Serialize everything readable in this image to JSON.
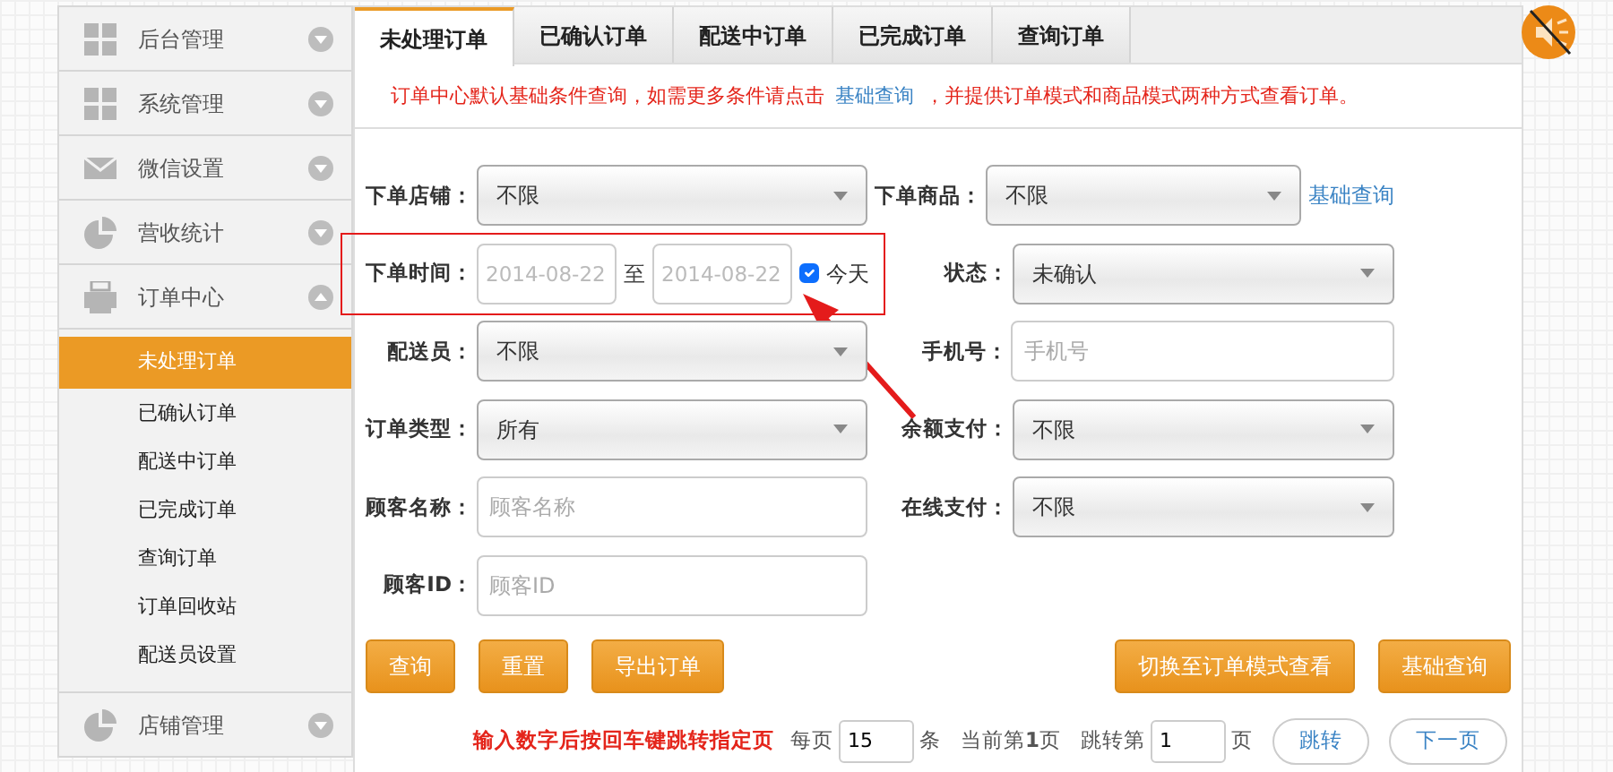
{
  "sidebar": {
    "items": [
      {
        "label": "后台管理",
        "kind": "grid",
        "expanded": false
      },
      {
        "label": "系统管理",
        "kind": "grid",
        "expanded": false
      },
      {
        "label": "微信设置",
        "kind": "mail",
        "expanded": false
      },
      {
        "label": "营收统计",
        "kind": "pie",
        "expanded": false
      },
      {
        "label": "订单中心",
        "kind": "printer",
        "expanded": true,
        "children": [
          {
            "label": "未处理订单",
            "selected": true
          },
          {
            "label": "已确认订单",
            "selected": false
          },
          {
            "label": "配送中订单",
            "selected": false
          },
          {
            "label": "已完成订单",
            "selected": false
          },
          {
            "label": "查询订单",
            "selected": false
          },
          {
            "label": "订单回收站",
            "selected": false
          },
          {
            "label": "配送员设置",
            "selected": false
          }
        ]
      },
      {
        "label": "店铺管理",
        "kind": "pie",
        "expanded": false
      }
    ]
  },
  "tabs": [
    {
      "label": "未处理订单",
      "selected": true
    },
    {
      "label": "已确认订单",
      "selected": false
    },
    {
      "label": "配送中订单",
      "selected": false
    },
    {
      "label": "已完成订单",
      "selected": false
    },
    {
      "label": "查询订单",
      "selected": false
    }
  ],
  "notice": {
    "text": "订单中心默认基础条件查询，如需更多条件请点击",
    "link": "基础查询",
    "text_after": "，并提供订单模式和商品模式两种方式查看订单。"
  },
  "form": {
    "rows": [
      {
        "left": {
          "kind": "select",
          "label": "下单店铺：",
          "value": "不限"
        },
        "right": {
          "kind": "select",
          "label": "下单商品：",
          "value": "不限",
          "link": "基础查询"
        }
      },
      {
        "highlighted": true,
        "left": {
          "kind": "date_range",
          "label": "下单时间：",
          "from_placeholder": "2014-08-22",
          "separator": "至",
          "to_placeholder": "2014-08-22",
          "checkbox": {
            "label": "今天",
            "checked": true
          }
        },
        "right": {
          "kind": "select",
          "label": "状态：",
          "value": "未确认"
        }
      },
      {
        "left": {
          "kind": "select",
          "label": "配送员：",
          "value": "不限"
        },
        "right": {
          "kind": "text",
          "label": "手机号：",
          "placeholder": "手机号"
        }
      },
      {
        "left": {
          "kind": "select",
          "label": "订单类型：",
          "value": "所有"
        },
        "right": {
          "kind": "select",
          "label": "余额支付：",
          "value": "不限"
        }
      },
      {
        "left": {
          "kind": "text",
          "label": "顾客名称：",
          "placeholder": "顾客名称"
        },
        "right": {
          "kind": "select",
          "label": "在线支付：",
          "value": "不限"
        }
      },
      {
        "left": {
          "kind": "text",
          "label": "顾客ID：",
          "placeholder": "顾客ID"
        }
      }
    ]
  },
  "actions": {
    "left": [
      "查询",
      "重置",
      "导出订单"
    ],
    "right": [
      "切换至订单模式查看",
      "基础查询"
    ]
  },
  "pagination": {
    "hint": "输入数字后按回车键跳转指定页",
    "per_page_label": "每页",
    "per_page": "15",
    "per_page_unit": "条",
    "current": "当前第**1**页",
    "jump_label": "跳转第",
    "jump_value": "1",
    "jump_unit": "页",
    "jump_button": "跳转",
    "next_button": "下一页"
  },
  "sound": {
    "muted": true
  }
}
